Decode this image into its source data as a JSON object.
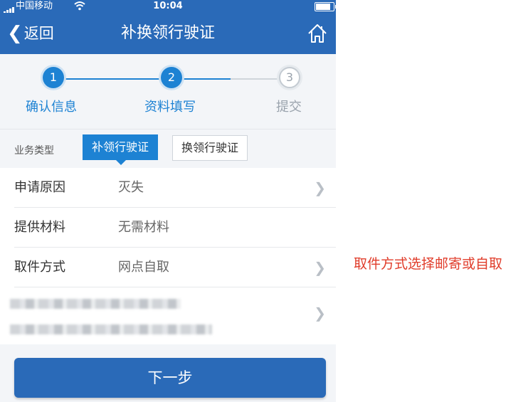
{
  "status_bar": {
    "carrier": "中国移动",
    "time": "10:04"
  },
  "nav": {
    "back_label": "返回",
    "title": "补换领行驶证"
  },
  "steps": [
    {
      "number": "1",
      "label": "确认信息",
      "state": "done"
    },
    {
      "number": "2",
      "label": "资料填写",
      "state": "active"
    },
    {
      "number": "3",
      "label": "提交",
      "state": "pending"
    }
  ],
  "business_type": {
    "label": "业务类型",
    "options": [
      "补领行驶证",
      "换领行驶证"
    ],
    "selected": "补领行驶证"
  },
  "rows": [
    {
      "key": "申请原因",
      "value": "灭失"
    },
    {
      "key": "提供材料",
      "value": "无需材料"
    },
    {
      "key": "取件方式",
      "value": "网点自取"
    }
  ],
  "next_button": "下一步",
  "annotation": "取件方式选择邮寄或自取",
  "colors": {
    "primary": "#2a6ab8",
    "step_active": "#1d82d3",
    "annotation": "#e03c2a"
  }
}
